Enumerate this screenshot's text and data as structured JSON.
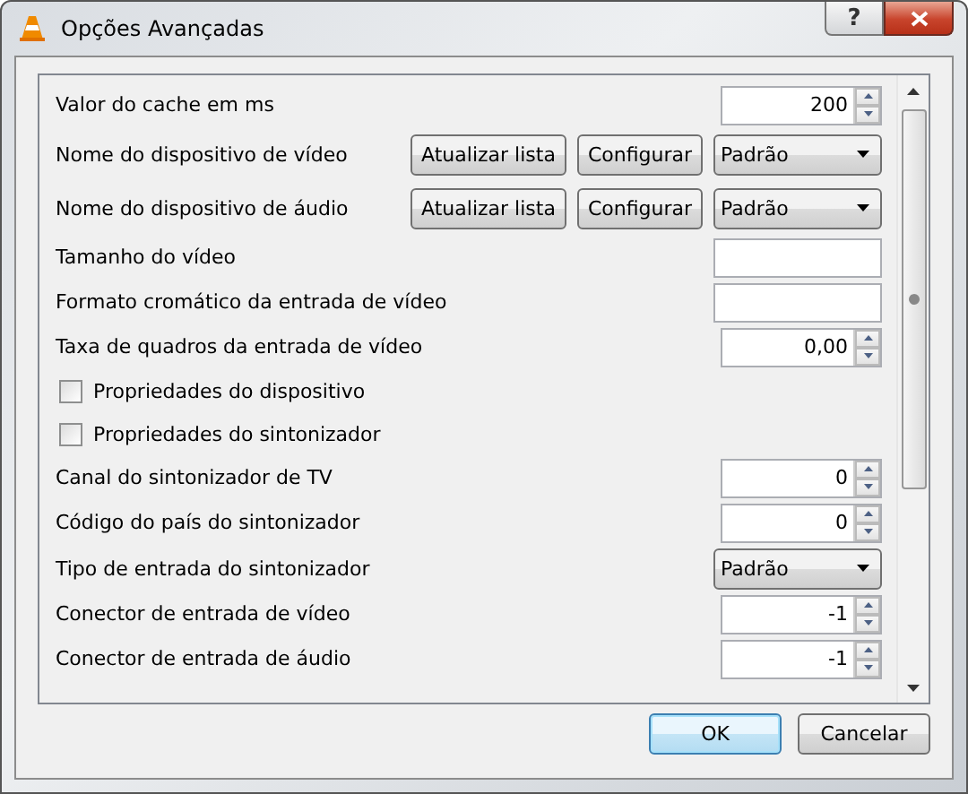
{
  "window": {
    "title": "Opções Avançadas",
    "help": "?"
  },
  "rows": [
    {
      "kind": "spin",
      "label": "Valor do cache em ms",
      "value": "200"
    },
    {
      "kind": "device",
      "label": "Nome do dispositivo de vídeo",
      "buttons": [
        "Atualizar lista",
        "Configurar"
      ],
      "combo": "Padrão"
    },
    {
      "kind": "device",
      "label": "Nome do dispositivo de áudio",
      "buttons": [
        "Atualizar lista",
        "Configurar"
      ],
      "combo": "Padrão"
    },
    {
      "kind": "text",
      "label": "Tamanho do vídeo"
    },
    {
      "kind": "text",
      "label": "Formato cromático da entrada de vídeo"
    },
    {
      "kind": "spin",
      "label": "Taxa de quadros da entrada de vídeo",
      "value": "0,00"
    },
    {
      "kind": "checkbox",
      "label": "Propriedades do dispositivo",
      "checked": false
    },
    {
      "kind": "checkbox",
      "label": "Propriedades do sintonizador",
      "checked": false
    },
    {
      "kind": "spin",
      "label": "Canal do sintonizador de TV",
      "value": "0"
    },
    {
      "kind": "spin",
      "label": "Código do país do sintonizador",
      "value": "0"
    },
    {
      "kind": "combo",
      "label": "Tipo de entrada do sintonizador",
      "combo": "Padrão"
    },
    {
      "kind": "spin",
      "label": "Conector de entrada de vídeo",
      "value": "-1"
    },
    {
      "kind": "spin",
      "label": "Conector de entrada de áudio",
      "value": "-1"
    }
  ],
  "buttons": [
    {
      "label": "OK",
      "default": true
    },
    {
      "label": "Cancelar",
      "default": false
    }
  ]
}
